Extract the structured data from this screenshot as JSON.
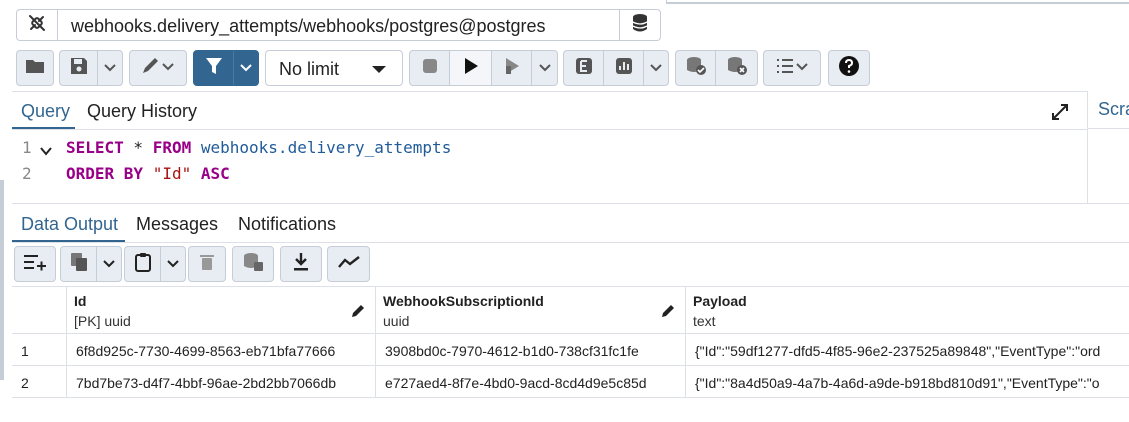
{
  "connection": {
    "label": "webhooks.delivery_attempts/webhooks/postgres@postgres",
    "icons": [
      "plug-icon",
      "database-icon"
    ]
  },
  "toolbar": {
    "limit_value": "No limit",
    "icons": [
      "folder-icon",
      "save-icon",
      "chevron-down-icon",
      "pencil-icon",
      "filter-icon",
      "stop-icon",
      "play-icon",
      "step-play-icon",
      "explain-icon",
      "chart-icon",
      "commit-icon",
      "rollback-icon",
      "macros-icon",
      "help-icon"
    ]
  },
  "query_tabs": [
    {
      "label": "Query",
      "active": true
    },
    {
      "label": "Query History",
      "active": false
    }
  ],
  "scratch_tab": "Scra",
  "editor": {
    "line_numbers": [
      "1",
      "2"
    ],
    "lines": [
      [
        {
          "t": "SELECT",
          "c": "kw"
        },
        {
          "t": " * ",
          "c": ""
        },
        {
          "t": "FROM",
          "c": "kw"
        },
        {
          "t": " webhooks.delivery_attempts",
          "c": "ident"
        }
      ],
      [
        {
          "t": "ORDER BY",
          "c": "kw"
        },
        {
          "t": " ",
          "c": ""
        },
        {
          "t": "\"Id\"",
          "c": "str"
        },
        {
          "t": " ",
          "c": ""
        },
        {
          "t": "ASC",
          "c": "kw"
        }
      ]
    ]
  },
  "output_tabs": [
    {
      "label": "Data Output",
      "active": true
    },
    {
      "label": "Messages",
      "active": false
    },
    {
      "label": "Notifications",
      "active": false
    }
  ],
  "output_toolbar_icons": [
    "add-row-icon",
    "copy-icon",
    "paste-icon",
    "delete-icon",
    "save-data-icon",
    "download-icon",
    "graph-icon"
  ],
  "grid": {
    "columns": [
      {
        "name": "Id",
        "type": "[PK] uuid",
        "editable": true
      },
      {
        "name": "WebhookSubscriptionId",
        "type": "uuid",
        "editable": true
      },
      {
        "name": "Payload",
        "type": "text",
        "editable": false
      }
    ],
    "rows": [
      {
        "num": "1",
        "cells": [
          "6f8d925c-7730-4699-8563-eb71bfa77666",
          "3908bd0c-7970-4612-b1d0-738cf31fc1fe",
          "{\"Id\":\"59df1277-dfd5-4f85-96e2-237525a89848\",\"EventType\":\"ord"
        ]
      },
      {
        "num": "2",
        "cells": [
          "7bd7be73-d4f7-4bbf-96ae-2bd2bb7066db",
          "e727aed4-8f7e-4bd0-9acd-8cd4d9e5c85d",
          "{\"Id\":\"8a4d50a9-4a7b-4a6d-a9de-b918bd810d91\",\"EventType\":\"o"
        ]
      }
    ]
  },
  "colors": {
    "accent": "#326690",
    "toolbar_bg": "#e8edf3",
    "border": "#c7cdd6"
  }
}
